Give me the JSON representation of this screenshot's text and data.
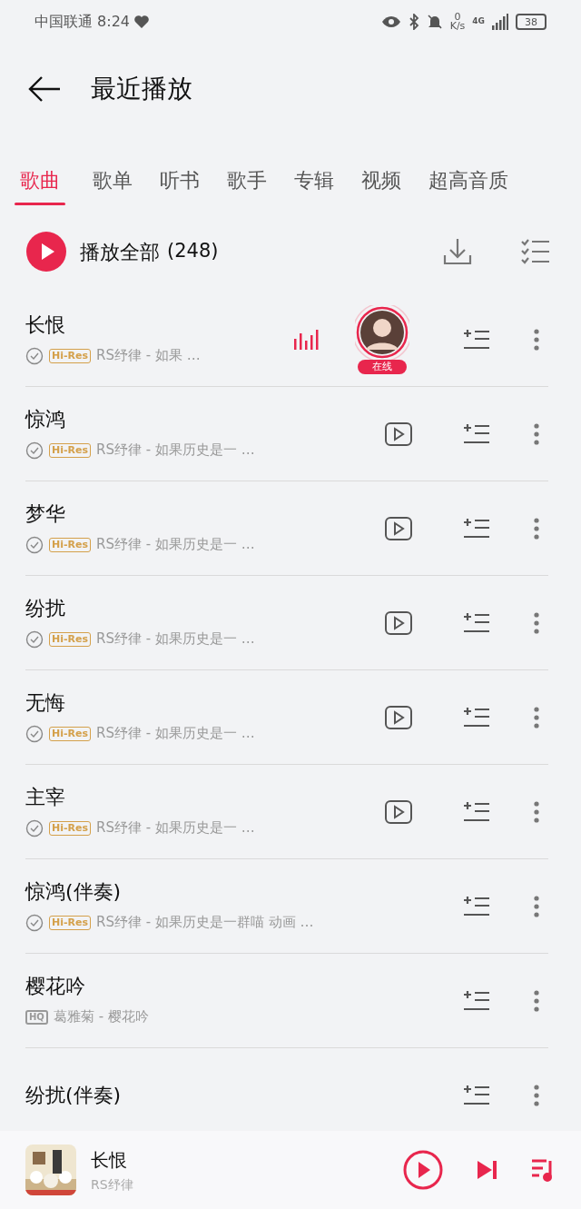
{
  "status_bar": {
    "carrier_time": "中国联通 8:24",
    "speed_value": "0",
    "speed_unit": "K/s",
    "network": "4G",
    "battery": "38"
  },
  "header": {
    "title": "最近播放"
  },
  "tabs": [
    {
      "label": "歌曲",
      "selected": true
    },
    {
      "label": "歌单",
      "selected": false
    },
    {
      "label": "听书",
      "selected": false
    },
    {
      "label": "歌手",
      "selected": false
    },
    {
      "label": "专辑",
      "selected": false
    },
    {
      "label": "视频",
      "selected": false
    },
    {
      "label": "超高音质",
      "selected": false
    }
  ],
  "play_all": {
    "label": "播放全部",
    "count": "(248)"
  },
  "songs": [
    {
      "title": "长恨",
      "downloaded": true,
      "quality": "Hi-Res",
      "subtitle": "RS纾律 - 如果 …",
      "kind": "playing",
      "live_badge": "在线"
    },
    {
      "title": "惊鸿",
      "downloaded": true,
      "quality": "Hi-Res",
      "subtitle": "RS纾律 - 如果历史是一 …",
      "kind": "mv"
    },
    {
      "title": "梦华",
      "downloaded": true,
      "quality": "Hi-Res",
      "subtitle": "RS纾律 - 如果历史是一 …",
      "kind": "mv"
    },
    {
      "title": "纷扰",
      "downloaded": true,
      "quality": "Hi-Res",
      "subtitle": "RS纾律 - 如果历史是一 …",
      "kind": "mv"
    },
    {
      "title": "无悔",
      "downloaded": true,
      "quality": "Hi-Res",
      "subtitle": "RS纾律 - 如果历史是一 …",
      "kind": "mv"
    },
    {
      "title": "主宰",
      "downloaded": true,
      "quality": "Hi-Res",
      "subtitle": "RS纾律 - 如果历史是一 …",
      "kind": "mv"
    },
    {
      "title": "惊鸿(伴奏)",
      "downloaded": true,
      "quality": "Hi-Res",
      "subtitle": "RS纾律 - 如果历史是一群喵 动画 …",
      "kind": "plain"
    },
    {
      "title": "樱花吟",
      "downloaded": false,
      "quality": "HQ",
      "subtitle": "葛雅菊 - 樱花吟",
      "kind": "plain"
    },
    {
      "title": "纷扰(伴奏)",
      "kind": "plain"
    }
  ],
  "player": {
    "title": "长恨",
    "artist": "RS纾律"
  }
}
